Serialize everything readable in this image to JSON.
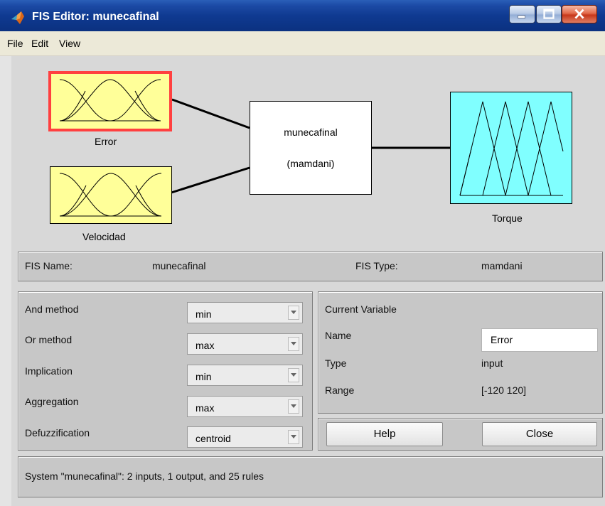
{
  "window": {
    "title": "FIS Editor: munecafinal"
  },
  "menu": {
    "items": [
      "File",
      "Edit",
      "View"
    ]
  },
  "diagram": {
    "inputs": [
      {
        "name": "Error",
        "selected": true,
        "color": "#ffff99"
      },
      {
        "name": "Velocidad",
        "selected": false,
        "color": "#ffff99"
      }
    ],
    "system": {
      "name": "munecafinal",
      "type_label": "(mamdani)"
    },
    "outputs": [
      {
        "name": "Torque",
        "color": "#80ffff"
      }
    ]
  },
  "fis_info": {
    "name_label": "FIS Name:",
    "name_value": "munecafinal",
    "type_label": "FIS Type:",
    "type_value": "mamdani"
  },
  "methods": [
    {
      "label": "And method",
      "value": "min"
    },
    {
      "label": "Or method",
      "value": "max"
    },
    {
      "label": "Implication",
      "value": "min"
    },
    {
      "label": "Aggregation",
      "value": "max"
    },
    {
      "label": "Defuzzification",
      "value": "centroid"
    }
  ],
  "current_variable": {
    "heading": "Current Variable",
    "name_label": "Name",
    "name_value": "Error",
    "type_label": "Type",
    "type_value": "input",
    "range_label": "Range",
    "range_value": "[-120 120]"
  },
  "buttons": {
    "help": "Help",
    "close": "Close"
  },
  "status": {
    "text": "System \"munecafinal\": 2 inputs, 1 output, and 25 rules"
  },
  "colors": {
    "selection_border": "#ff4040",
    "input_fill": "#ffff99",
    "output_fill": "#80ffff"
  }
}
